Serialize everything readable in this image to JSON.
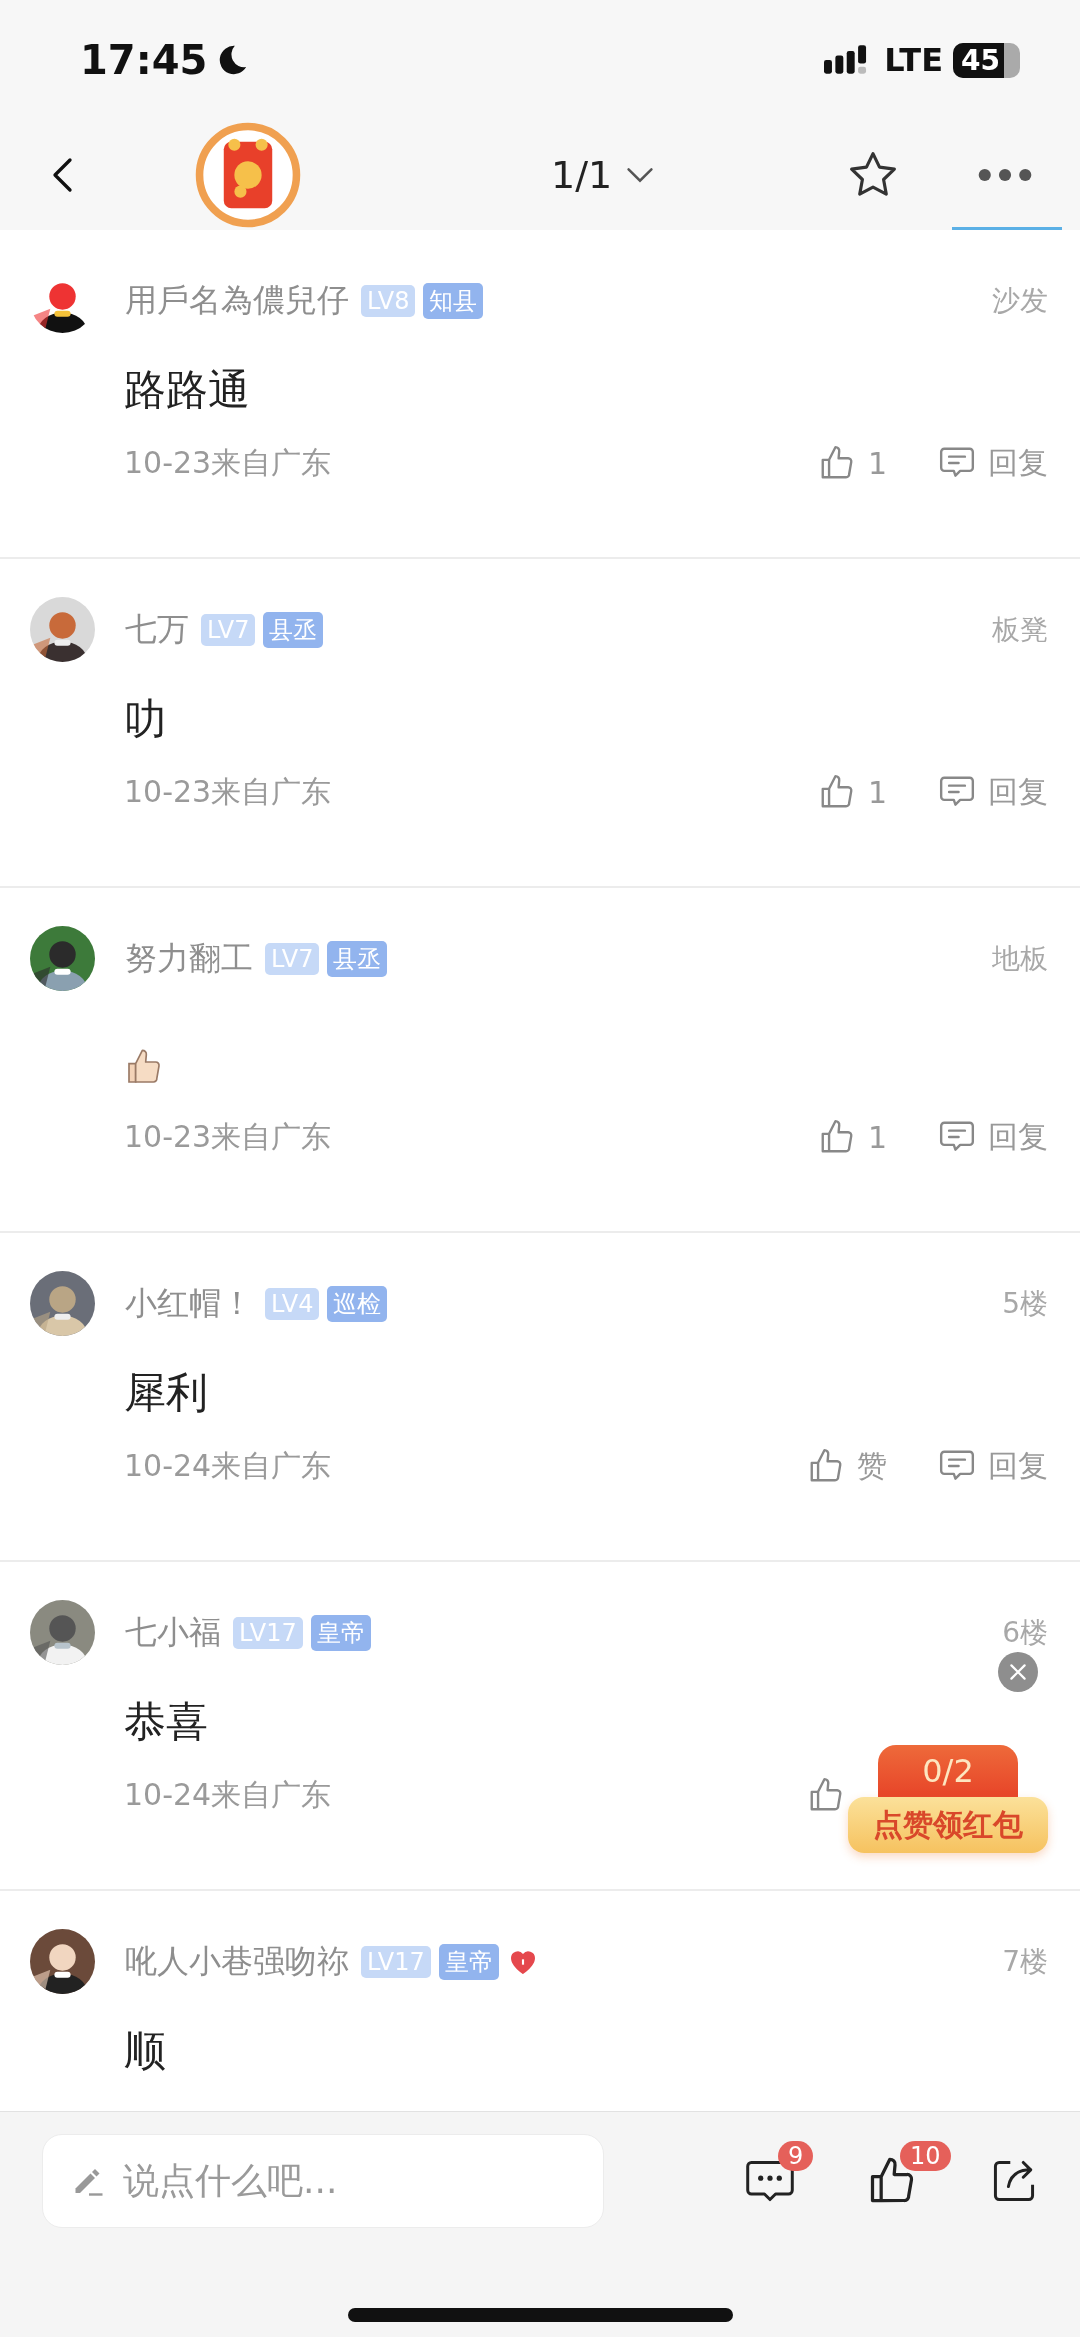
{
  "status_bar": {
    "time": "17:45",
    "network": "LTE",
    "battery": "45"
  },
  "nav": {
    "page_indicator": "1/1"
  },
  "comments": [
    {
      "user": "用戶名為儂兒仔",
      "level": "LV8",
      "title": "知县",
      "heart": false,
      "floor": "沙发",
      "content": {
        "kind": "text",
        "text": "路路通"
      },
      "meta": "10-23来自广东",
      "like": {
        "label": "1"
      },
      "reply": {
        "label": "回复"
      }
    },
    {
      "user": "七万",
      "level": "LV7",
      "title": "县丞",
      "heart": false,
      "floor": "板凳",
      "content": {
        "kind": "text",
        "text": "叻"
      },
      "meta": "10-23来自广东",
      "like": {
        "label": "1"
      },
      "reply": {
        "label": "回复"
      }
    },
    {
      "user": "努力翻工",
      "level": "LV7",
      "title": "县丞",
      "heart": false,
      "floor": "地板",
      "content": {
        "kind": "emoji"
      },
      "meta": "10-23来自广东",
      "like": {
        "label": "1"
      },
      "reply": {
        "label": "回复"
      }
    },
    {
      "user": "小红帽！",
      "level": "LV4",
      "title": "巡检",
      "heart": false,
      "floor": "5楼",
      "content": {
        "kind": "text",
        "text": "犀利"
      },
      "meta": "10-24来自广东",
      "like": {
        "label": "赞"
      },
      "reply": {
        "label": "回复"
      }
    },
    {
      "user": "七小福",
      "level": "LV17",
      "title": "皇帝",
      "heart": false,
      "floor": "6楼",
      "content": {
        "kind": "text",
        "text": "恭喜"
      },
      "meta": "10-24来自广东",
      "like": {
        "kind": "icon"
      }
    },
    {
      "user": "吪人小巷强吻祢",
      "level": "LV17",
      "title": "皇帝",
      "heart": true,
      "floor": "7楼",
      "content": {
        "kind": "text",
        "text": "顺"
      }
    }
  ],
  "promo": {
    "counter": "0/2",
    "label": "点赞领红包"
  },
  "composer": {
    "placeholder": "说点什么吧..."
  },
  "toolbar": {
    "comments_badge": "9",
    "likes_badge": "10"
  }
}
